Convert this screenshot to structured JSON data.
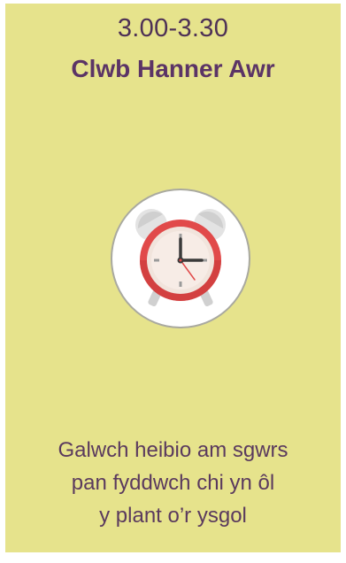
{
  "card": {
    "time": "3.00-3.30",
    "title": "Clwb Hanner Awr",
    "icon": "alarm-clock-icon",
    "message_lines": [
      "Galwch heibio am sgwrs",
      "pan fyddwch chi yn ôl",
      "y plant o’r ysgol"
    ]
  },
  "colors": {
    "background": "#e6e38c",
    "title": "#5b3466",
    "text": "#5a3a5e",
    "clock_red": "#e14a4a"
  }
}
